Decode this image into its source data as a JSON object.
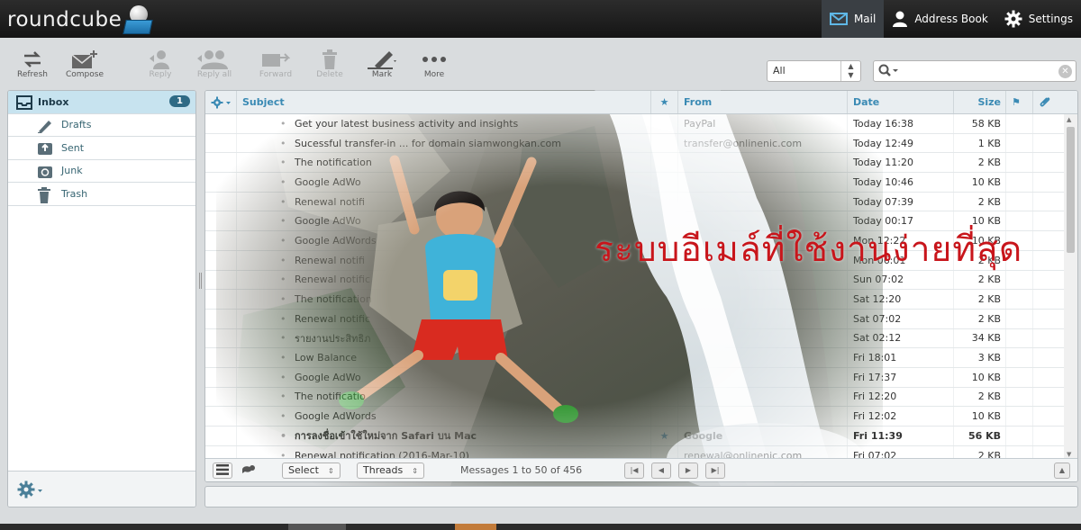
{
  "app": {
    "logo_text": "roundcube"
  },
  "topnav": {
    "mail": "Mail",
    "address_book": "Address Book",
    "settings": "Settings"
  },
  "toolbar": {
    "refresh": "Refresh",
    "compose": "Compose",
    "reply": "Reply",
    "reply_all": "Reply all",
    "forward": "Forward",
    "delete": "Delete",
    "mark": "Mark",
    "more": "More"
  },
  "filter": {
    "selected": "All"
  },
  "folders": {
    "items": [
      {
        "label": "Inbox",
        "count": "1"
      },
      {
        "label": "Drafts"
      },
      {
        "label": "Sent"
      },
      {
        "label": "Junk"
      },
      {
        "label": "Trash"
      }
    ]
  },
  "list": {
    "headers": {
      "subject": "Subject",
      "from": "From",
      "date": "Date",
      "size": "Size"
    },
    "rows": [
      {
        "subject": "Get your latest business activity and insights",
        "from": "PayPal",
        "date": "Today 16:38",
        "size": "58 KB"
      },
      {
        "subject": "Sucessful transfer-in ... for domain siamwongkan.com",
        "from": "transfer@onlinenic.com",
        "date": "Today 12:49",
        "size": "1 KB"
      },
      {
        "subject": "The notification",
        "from": "",
        "date": "Today 11:20",
        "size": "2 KB"
      },
      {
        "subject": "Google AdWo",
        "from": "",
        "date": "Today 10:46",
        "size": "10 KB"
      },
      {
        "subject": "Renewal notifi",
        "from": "",
        "date": "Today 07:39",
        "size": "2 KB"
      },
      {
        "subject": "Google AdWo",
        "from": "",
        "date": "Today 00:17",
        "size": "10 KB"
      },
      {
        "subject": "Google AdWords",
        "from": "",
        "date": "Mon 12:22",
        "size": "10 KB"
      },
      {
        "subject": "Renewal notifi",
        "from": "",
        "date": "Mon 06:01",
        "size": "2 KB"
      },
      {
        "subject": "Renewal notific",
        "from": "",
        "date": "Sun 07:02",
        "size": "2 KB"
      },
      {
        "subject": "The notification",
        "from": "",
        "date": "Sat 12:20",
        "size": "2 KB"
      },
      {
        "subject": "Renewal notific",
        "from": "",
        "date": "Sat 07:02",
        "size": "2 KB"
      },
      {
        "subject": "รายงานประสิทธิภ",
        "from": "",
        "date": "Sat 02:12",
        "size": "34 KB"
      },
      {
        "subject": "Low Balance",
        "from": "",
        "date": "Fri 18:01",
        "size": "3 KB"
      },
      {
        "subject": "Google AdWo",
        "from": "",
        "date": "Fri 17:37",
        "size": "10 KB"
      },
      {
        "subject": "The notificatio",
        "from": "",
        "date": "Fri 12:20",
        "size": "2 KB"
      },
      {
        "subject": "Google AdWords",
        "from": "",
        "date": "Fri 12:02",
        "size": "10 KB"
      },
      {
        "subject": "การลงชื่อเข้าใช้ใหม่จาก Safari บน Mac",
        "from": "Google",
        "date": "Fri 11:39",
        "size": "56 KB",
        "unread": true,
        "starred": true
      },
      {
        "subject": "Renewal notification (2016-Mar-10)",
        "from": "renewal@onlinenic.com",
        "date": "Fri 07:02",
        "size": "2 KB"
      }
    ]
  },
  "list_footer": {
    "select": "Select",
    "threads": "Threads",
    "count_text": "Messages 1 to 50 of 456"
  },
  "overlay": {
    "text": "ระบบอีเมล์ที่ใช้งานง่ายที่สุด"
  },
  "colors": {
    "accent": "#3a8ab4",
    "selected_folder": "#c7e3ef",
    "overlay_text": "#c8151b"
  }
}
